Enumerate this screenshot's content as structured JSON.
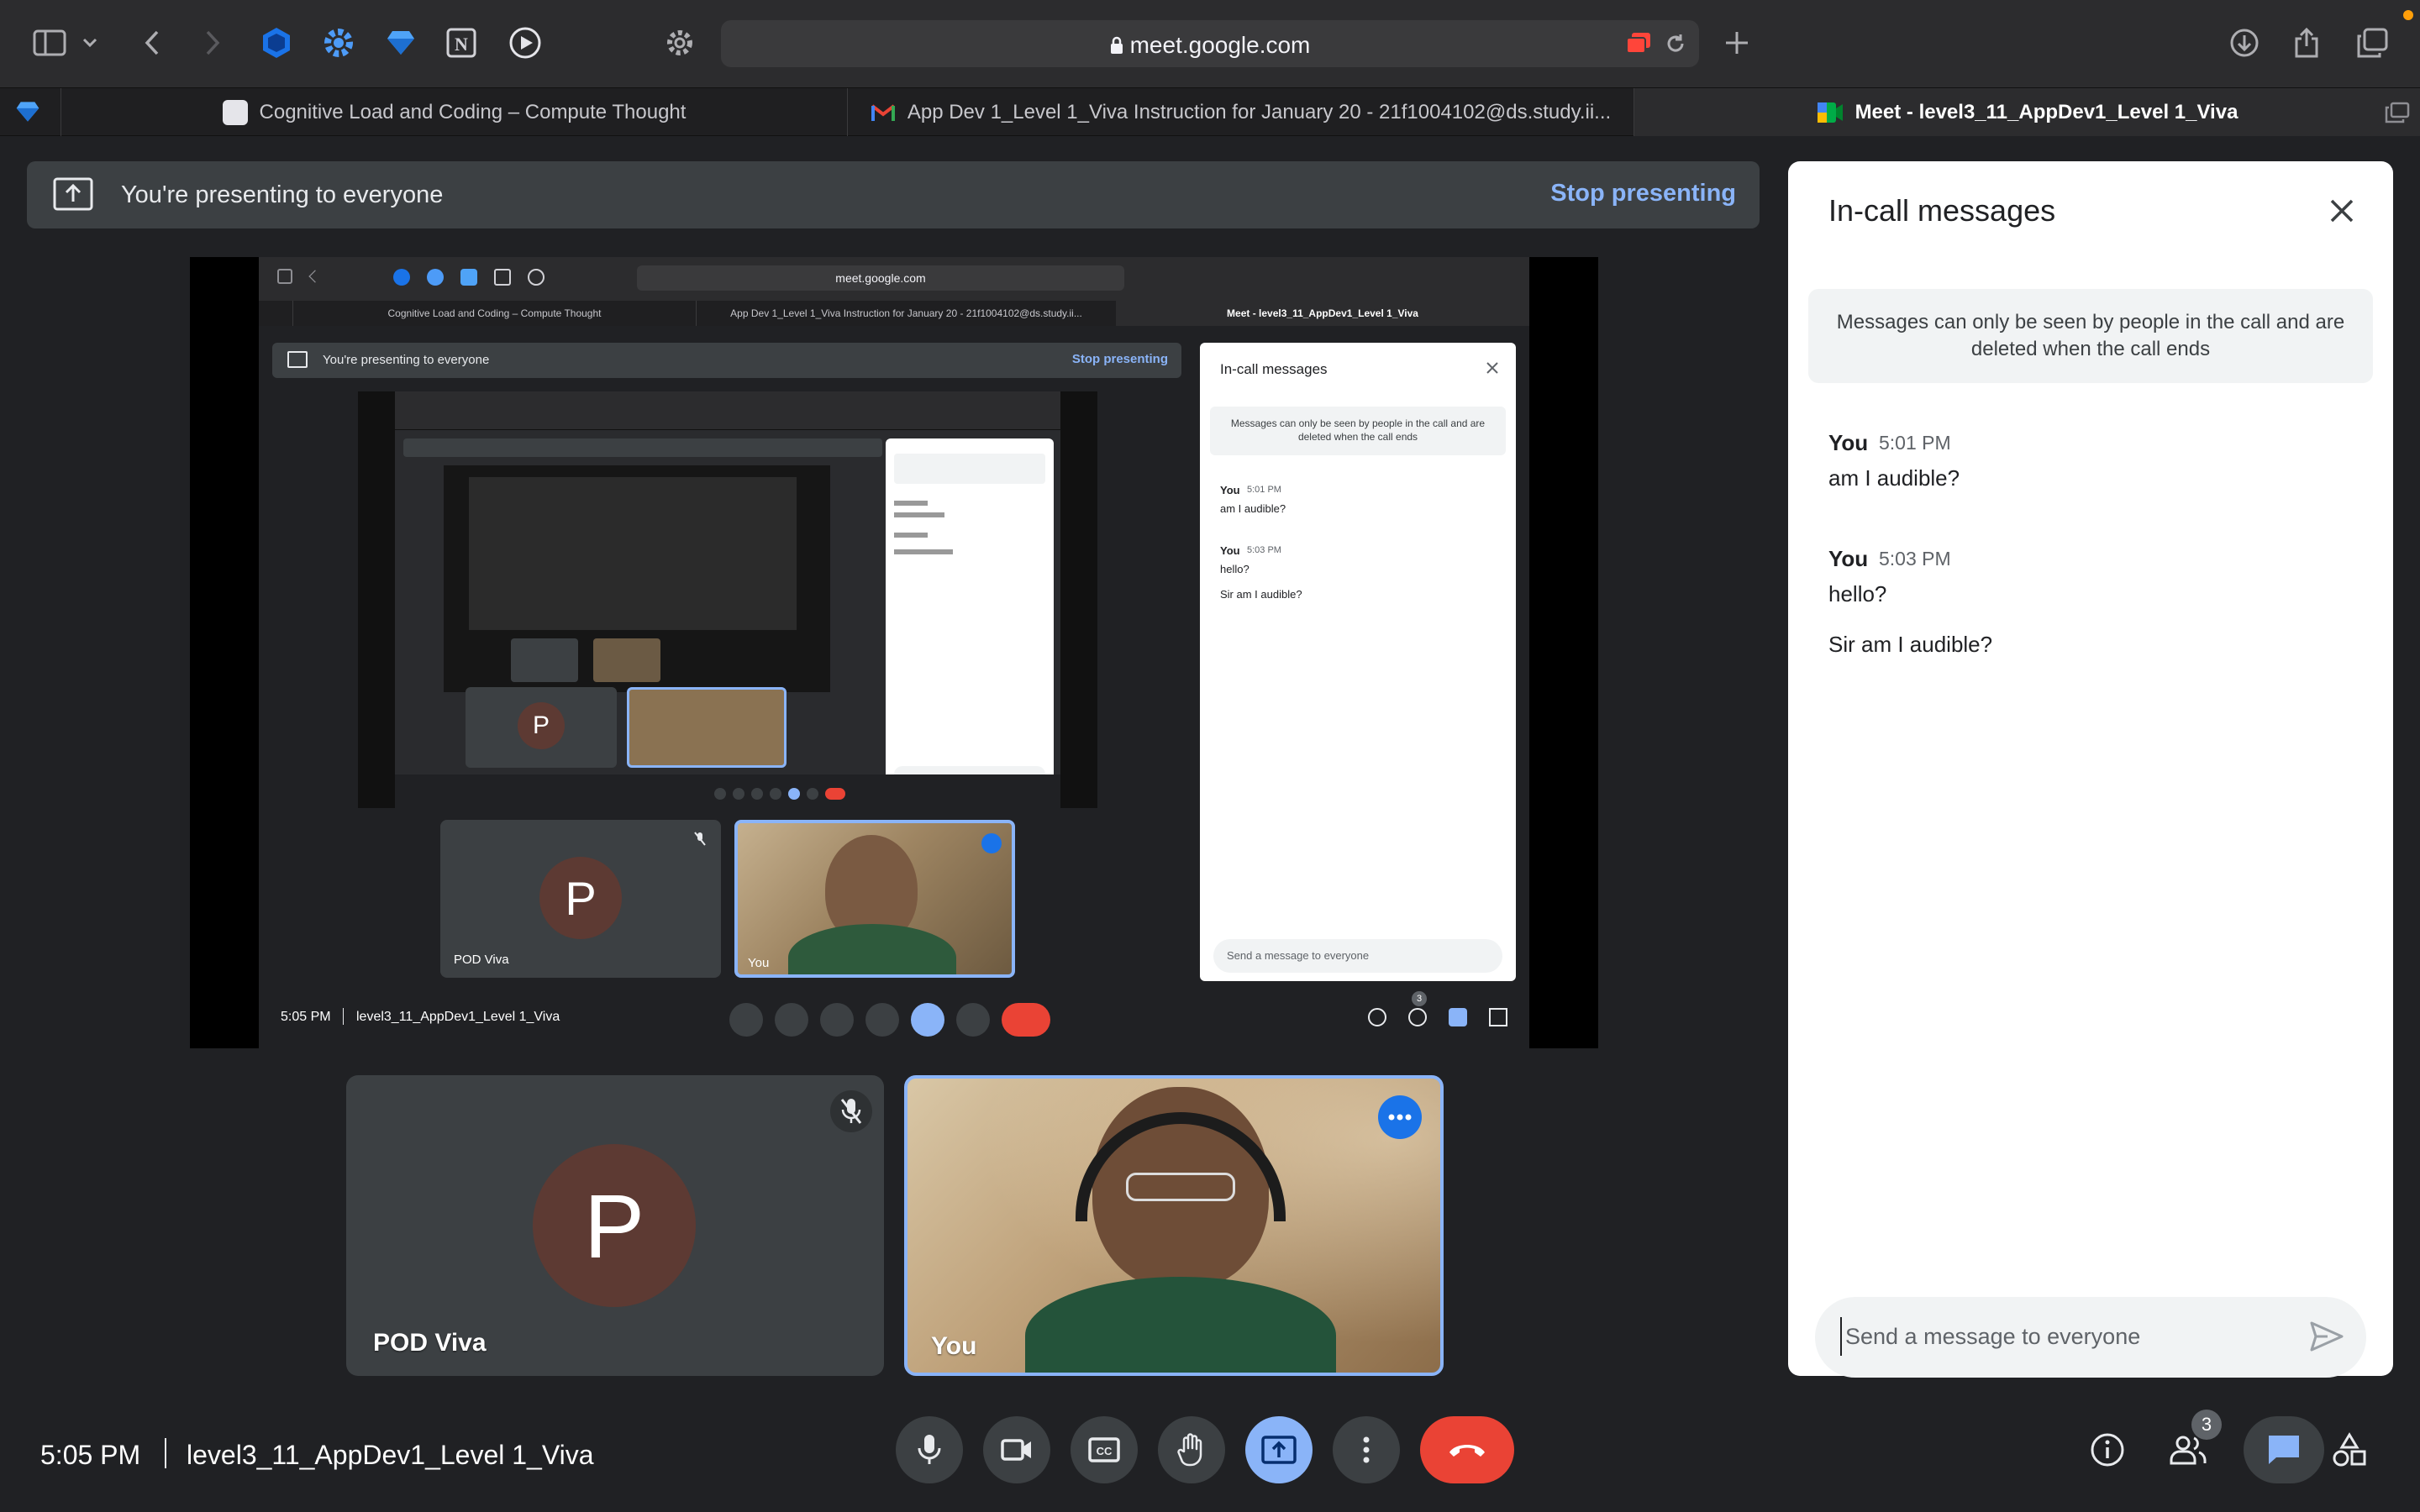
{
  "browser": {
    "address": "meet.google.com",
    "tabs": [
      {
        "title": "Cognitive Load and Coding – Compute Thought"
      },
      {
        "title": "App Dev 1_Level 1_Viva Instruction for January 20 - 21f1004102@ds.study.ii..."
      },
      {
        "title": "Meet - level3_11_AppDev1_Level 1_Viva"
      }
    ]
  },
  "presenting": {
    "message": "You're presenting to everyone",
    "stop_label": "Stop presenting"
  },
  "shared_screen": {
    "address": "meet.google.com",
    "tab1": "Cognitive Load and Coding – Compute Thought",
    "tab2": "App Dev 1_Level 1_Viva Instruction for January 20 - 21f1004102@ds.study.ii...",
    "tab3": "Meet - level3_11_AppDev1_Level 1_Viva",
    "present_msg": "You're presenting to everyone",
    "stop_label": "Stop presenting",
    "chat_title": "In-call messages",
    "chat_info": "Messages can only be seen by people in the call and are deleted when the call ends",
    "m1_sender": "You",
    "m1_time": "5:01 PM",
    "m1_text": "am I audible?",
    "m2_sender": "You",
    "m2_time": "5:03 PM",
    "m2_text": "hello?",
    "m3_text": "Sir am I audible?",
    "input_placeholder": "Send a message to everyone",
    "tile1_name": "POD Viva",
    "tile1_initial": "P",
    "tile2_name": "You",
    "clock": "5:05 PM",
    "meeting": "level3_11_AppDev1_Level 1_Viva",
    "people_count": "3"
  },
  "participants": [
    {
      "name": "POD Viva",
      "initial": "P",
      "muted": true
    },
    {
      "name": "You",
      "muted": false
    }
  ],
  "chat": {
    "title": "In-call messages",
    "info": "Messages can only be seen by people in the call and are deleted when the call ends",
    "messages": [
      {
        "sender": "You",
        "time": "5:01 PM",
        "texts": [
          "am I audible?"
        ]
      },
      {
        "sender": "You",
        "time": "5:03 PM",
        "texts": [
          "hello?",
          "Sir am I audible?"
        ]
      }
    ],
    "input_placeholder": "Send a message to everyone"
  },
  "footer": {
    "time": "5:05 PM",
    "meeting_name": "level3_11_AppDev1_Level 1_Viva",
    "people_count": "3"
  },
  "colors": {
    "background": "#202124",
    "accent_blue": "#8ab4f8",
    "end_call_red": "#ea4335",
    "avatar_brown": "#5d3a33",
    "active_tile_border": "#8ab4f8"
  }
}
